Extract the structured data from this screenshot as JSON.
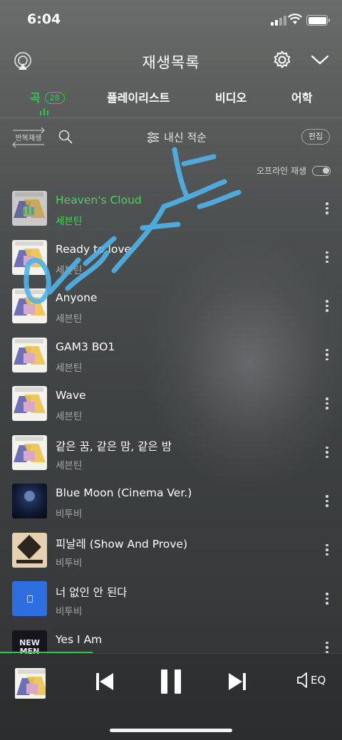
{
  "status_bar": {
    "time": "6:04"
  },
  "header": {
    "title": "재생목록"
  },
  "tabs": [
    {
      "label": "곡",
      "count": "28",
      "active": true
    },
    {
      "label": "플레이리스트"
    },
    {
      "label": "비디오"
    },
    {
      "label": "어학"
    }
  ],
  "toolbar": {
    "repeat_label": "반복재생",
    "sort_label": "내신 적순",
    "edit_label": "편집"
  },
  "offline": {
    "label": "오프라인 재생",
    "enabled": false
  },
  "songs": [
    {
      "title": "Heaven's Cloud",
      "artist": "세븐틴",
      "art": "seventeen",
      "playing": true
    },
    {
      "title": "Ready to love",
      "artist": "세븐틴",
      "art": "seventeen"
    },
    {
      "title": "Anyone",
      "artist": "세븐틴",
      "art": "seventeen"
    },
    {
      "title": "GAM3 BO1",
      "artist": "세븐틴",
      "art": "seventeen"
    },
    {
      "title": "Wave",
      "artist": "세븐틴",
      "art": "seventeen"
    },
    {
      "title": "같은 꿈, 같은 맘, 같은 밤",
      "artist": "세븐틴",
      "art": "seventeen"
    },
    {
      "title": "Blue Moon (Cinema Ver.)",
      "artist": "비투비",
      "art": "btob-moon"
    },
    {
      "title": "피날레 (Show And Prove)",
      "artist": "비투비",
      "art": "btob-show"
    },
    {
      "title": "너 없인 안 된다",
      "artist": "비투비",
      "art": "btob-blue"
    },
    {
      "title": "Yes I Am",
      "artist": "",
      "art": "btob-new"
    }
  ],
  "album_art_text": {
    "new_men": "NEW MEN"
  },
  "player": {
    "eq_label": "EQ",
    "progress": 0.27
  },
  "colors": {
    "accent": "#2fc94a",
    "scribble": "#4fb4ea"
  }
}
